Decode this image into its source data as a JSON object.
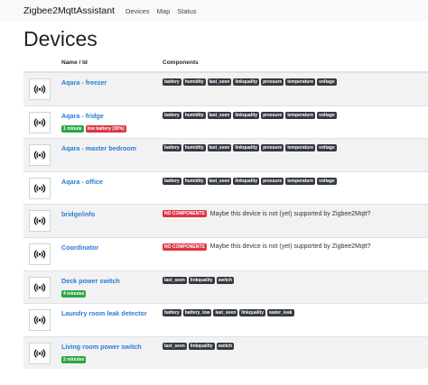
{
  "navbar": {
    "brand": "Zigbee2MqttAssistant",
    "links": [
      "Devices",
      "Map",
      "Status"
    ]
  },
  "page_title": "Devices",
  "table": {
    "headers": {
      "name": "Name / Id",
      "components": "Components"
    },
    "rows": [
      {
        "name": "Aqara - freezer",
        "badges": [],
        "components": [
          "battery",
          "humidity",
          "last_seen",
          "linkquality",
          "pressure",
          "temperature",
          "voltage"
        ],
        "note": ""
      },
      {
        "name": "Aqara - fridge",
        "badges": [
          {
            "text": "1 minute",
            "color": "green"
          },
          {
            "text": "low battery (30%)",
            "color": "red"
          }
        ],
        "components": [
          "battery",
          "humidity",
          "last_seen",
          "linkquality",
          "pressure",
          "temperature",
          "voltage"
        ],
        "note": ""
      },
      {
        "name": "Aqara - master bedroom",
        "badges": [],
        "components": [
          "battery",
          "humidity",
          "last_seen",
          "linkquality",
          "pressure",
          "temperature",
          "voltage"
        ],
        "note": ""
      },
      {
        "name": "Aqara - office",
        "badges": [],
        "components": [
          "battery",
          "humidity",
          "last_seen",
          "linkquality",
          "pressure",
          "temperature",
          "voltage"
        ],
        "note": ""
      },
      {
        "name": "bridge/info",
        "badges": [],
        "components": [],
        "no_components": "NO COMPONENTS",
        "note": "Maybe this device is not (yet) supported by Zigbee2Mqtt?"
      },
      {
        "name": "Coordinator",
        "badges": [],
        "components": [],
        "no_components": "NO COMPONENTS",
        "note": "Maybe this device is not (yet) supported by Zigbee2Mqtt?"
      },
      {
        "name": "Deck power switch",
        "badges": [
          {
            "text": "4 minutes",
            "color": "green"
          }
        ],
        "components": [
          "last_seen",
          "linkquality",
          "switch"
        ],
        "note": ""
      },
      {
        "name": "Laundry room leak detector",
        "badges": [],
        "components": [
          "battery",
          "battery_low",
          "last_seen",
          "linkquality",
          "water_leak"
        ],
        "note": ""
      },
      {
        "name": "Living room power switch",
        "badges": [
          {
            "text": "2 minutes",
            "color": "green"
          }
        ],
        "components": [
          "last_seen",
          "linkquality",
          "switch"
        ],
        "note": ""
      }
    ]
  },
  "colors": {
    "link": "#2a7bd6",
    "chip": "#343a40",
    "badge_green": "#28a745",
    "badge_red": "#dc3545"
  },
  "icons": {
    "device": "wireless-signal-icon"
  }
}
